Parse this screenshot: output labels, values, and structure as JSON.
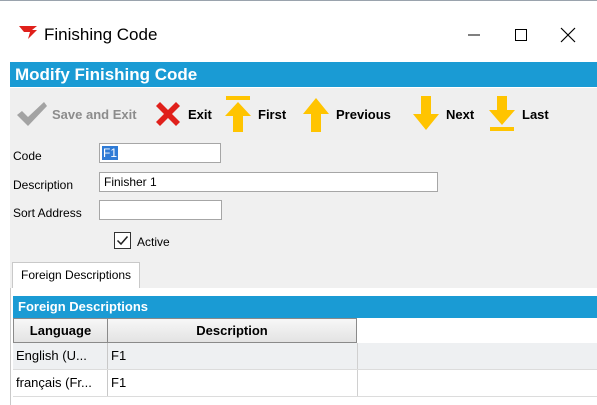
{
  "window": {
    "title": "Finishing Code",
    "controls": {
      "minimize": "—",
      "maximize": "☐",
      "close": "✕"
    }
  },
  "header": {
    "title": "Modify Finishing Code"
  },
  "toolbar": {
    "buttons": [
      {
        "label": "Save and Exit",
        "icon": "checkmark-icon",
        "enabled": false
      },
      {
        "label": "Exit",
        "icon": "red-x-icon",
        "enabled": true
      },
      {
        "label": "First",
        "icon": "arrow-up-to-bar-icon",
        "enabled": true
      },
      {
        "label": "Previous",
        "icon": "arrow-up-icon",
        "enabled": true
      },
      {
        "label": "Next",
        "icon": "arrow-down-icon",
        "enabled": true
      },
      {
        "label": "Last",
        "icon": "arrow-down-to-bar-icon",
        "enabled": true
      }
    ]
  },
  "form": {
    "code_label": "Code",
    "code_value": "F1",
    "description_label": "Description",
    "description_value": "Finisher 1",
    "sort_address_label": "Sort Address",
    "sort_address_value": "",
    "active_label": "Active",
    "active_checked": true
  },
  "tabs": [
    {
      "label": "Foreign Descriptions",
      "selected": true
    }
  ],
  "grid": {
    "title": "Foreign Descriptions",
    "columns": [
      "Language",
      "Description"
    ],
    "rows": [
      {
        "language": "English (U...",
        "description": "F1"
      },
      {
        "language": "français (Fr...",
        "description": "F1"
      }
    ]
  },
  "colors": {
    "accent": "#1a9bd4",
    "icon_yellow": "#ffc400",
    "icon_red": "#e0201b",
    "disabled_gray": "#8c8c8c"
  }
}
